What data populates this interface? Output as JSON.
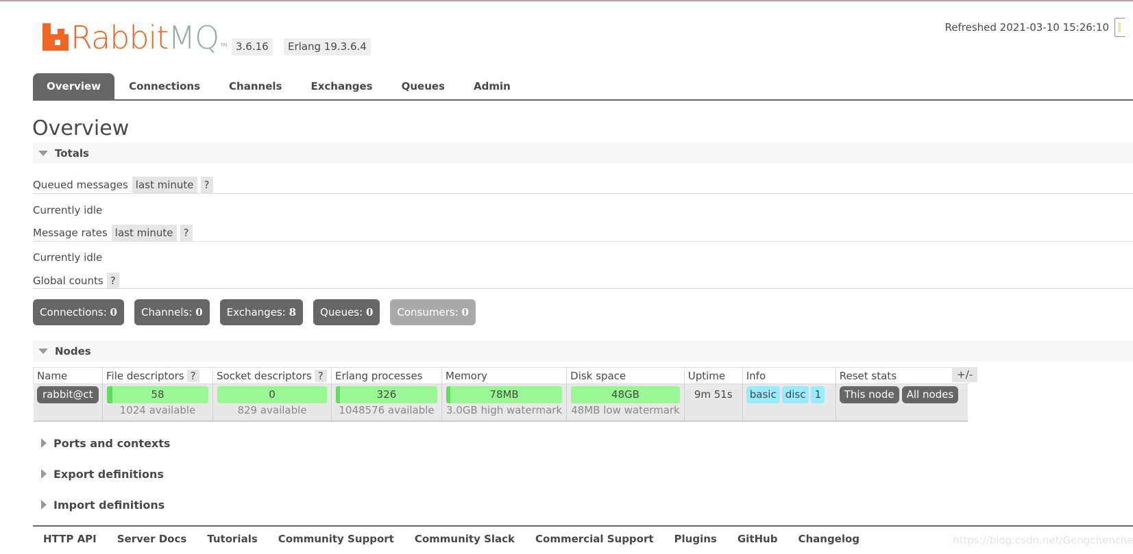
{
  "header": {
    "logo_rabbit": "Rabbit",
    "logo_mq": "MQ",
    "logo_tm": "TM",
    "version": "3.6.16",
    "erlang": "Erlang 19.3.6.4",
    "refreshed": "Refreshed 2021-03-10 15:26:10"
  },
  "tabs": [
    {
      "label": "Overview",
      "active": true
    },
    {
      "label": "Connections"
    },
    {
      "label": "Channels"
    },
    {
      "label": "Exchanges"
    },
    {
      "label": "Queues"
    },
    {
      "label": "Admin"
    }
  ],
  "page_title": "Overview",
  "totals": {
    "section_label": "Totals",
    "queued_messages_label": "Queued messages",
    "queued_messages_range": "last minute",
    "help": "?",
    "queued_status": "Currently idle",
    "message_rates_label": "Message rates",
    "message_rates_range": "last minute",
    "message_rates_status": "Currently idle",
    "global_counts_label": "Global counts",
    "counts": [
      {
        "label": "Connections:",
        "value": "0"
      },
      {
        "label": "Channels:",
        "value": "0"
      },
      {
        "label": "Exchanges:",
        "value": "8"
      },
      {
        "label": "Queues:",
        "value": "0"
      },
      {
        "label": "Consumers:",
        "value": "0"
      }
    ]
  },
  "nodes": {
    "section_label": "Nodes",
    "columns": [
      "Name",
      "File descriptors",
      "Socket descriptors",
      "Erlang processes",
      "Memory",
      "Disk space",
      "Uptime",
      "Info",
      "Reset stats"
    ],
    "help": "?",
    "toggle_columns": "+/-",
    "row": {
      "name": "rabbit@ct",
      "file_descriptors": {
        "used": "58",
        "available": "1024 available",
        "fraction": 0.057
      },
      "socket_descriptors": {
        "used": "0",
        "available": "829 available",
        "fraction": 0
      },
      "erlang_processes": {
        "used": "326",
        "available": "1048576 available",
        "fraction": 0.0003
      },
      "memory": {
        "used": "78MB",
        "watermark": "3.0GB high watermark",
        "fraction": 0.025
      },
      "disk_space": {
        "free": "48GB",
        "watermark": "48MB low watermark"
      },
      "uptime": "9m 51s",
      "info": [
        "basic",
        "disc",
        "1"
      ],
      "reset": [
        "This node",
        "All nodes"
      ]
    }
  },
  "collapsed_sections": [
    "Ports and contexts",
    "Export definitions",
    "Import definitions"
  ],
  "footer": {
    "links": [
      "HTTP API",
      "Server Docs",
      "Tutorials",
      "Community Support",
      "Community Slack",
      "Commercial Support",
      "Plugins",
      "GitHub",
      "Changelog"
    ],
    "watermark": "https://blog.csdn.net/Gengchenchen"
  },
  "colors": {
    "brand_orange": "#f26522",
    "brand_grey": "#99aaa6",
    "bar_green": "#99f894",
    "info_blue": "#99ebff",
    "dark_button": "#666666"
  }
}
